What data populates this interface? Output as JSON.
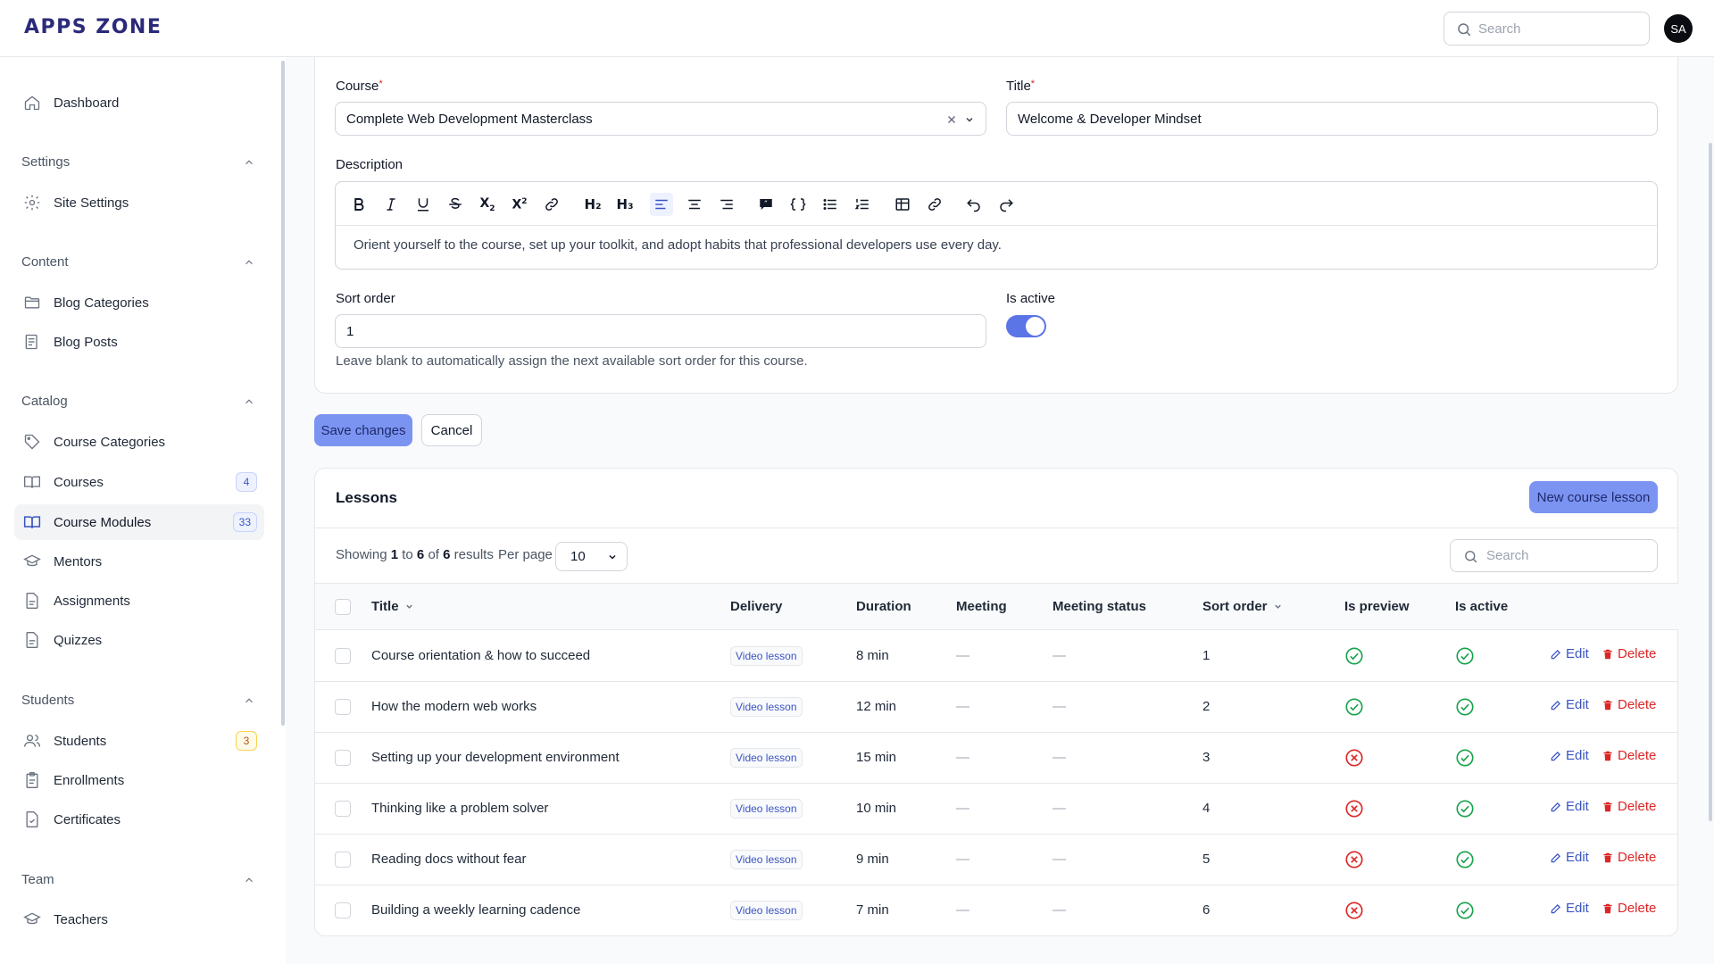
{
  "app": {
    "logo": "APPS ZONE",
    "search_placeholder": "Search",
    "avatar_initials": "SA"
  },
  "sidebar": {
    "dashboard": "Dashboard",
    "groups": {
      "settings": "Settings",
      "content": "Content",
      "catalog": "Catalog",
      "students": "Students",
      "team": "Team"
    },
    "items": {
      "site_settings": "Site Settings",
      "blog_categories": "Blog Categories",
      "blog_posts": "Blog Posts",
      "course_categories": "Course Categories",
      "courses": "Courses",
      "courses_count": "4",
      "course_modules": "Course Modules",
      "course_modules_count": "33",
      "mentors": "Mentors",
      "assignments": "Assignments",
      "quizzes": "Quizzes",
      "students": "Students",
      "students_count": "3",
      "enrollments": "Enrollments",
      "certificates": "Certificates",
      "teachers": "Teachers"
    }
  },
  "form": {
    "course_label": "Course",
    "course_value": "Complete Web Development Masterclass",
    "title_label": "Title",
    "title_value": "Welcome & Developer Mindset",
    "description_label": "Description",
    "description_value": "Orient yourself to the course, set up your toolkit, and adopt habits that professional developers use every day.",
    "sort_order_label": "Sort order",
    "sort_order_value": "1",
    "sort_order_help": "Leave blank to automatically assign the next available sort order for this course.",
    "is_active_label": "Is active",
    "is_active": true,
    "toolbar": {
      "h2": "H₂",
      "h3": "H₃"
    }
  },
  "actions": {
    "save": "Save changes",
    "cancel": "Cancel"
  },
  "lessons": {
    "title": "Lessons",
    "new_button": "New course lesson",
    "showing_prefix": "Showing",
    "from": "1",
    "to_word": "to",
    "to": "6",
    "of_word": "of",
    "total": "6",
    "results_word": "results",
    "per_page_label": "Per page",
    "per_page_value": "10",
    "search_placeholder": "Search",
    "columns": {
      "title": "Title",
      "delivery": "Delivery",
      "duration": "Duration",
      "meeting": "Meeting",
      "meeting_status": "Meeting status",
      "sort_order": "Sort order",
      "is_preview": "Is preview",
      "is_active": "Is active"
    },
    "edit_label": "Edit",
    "delete_label": "Delete",
    "rows": [
      {
        "title": "Course orientation & how to succeed",
        "delivery": "Video lesson",
        "duration": "8 min",
        "meeting": "—",
        "meeting_status": "—",
        "sort_order": "1",
        "is_preview": true,
        "is_active": true
      },
      {
        "title": "How the modern web works",
        "delivery": "Video lesson",
        "duration": "12 min",
        "meeting": "—",
        "meeting_status": "—",
        "sort_order": "2",
        "is_preview": true,
        "is_active": true
      },
      {
        "title": "Setting up your development environment",
        "delivery": "Video lesson",
        "duration": "15 min",
        "meeting": "—",
        "meeting_status": "—",
        "sort_order": "3",
        "is_preview": false,
        "is_active": true
      },
      {
        "title": "Thinking like a problem solver",
        "delivery": "Video lesson",
        "duration": "10 min",
        "meeting": "—",
        "meeting_status": "—",
        "sort_order": "4",
        "is_preview": false,
        "is_active": true
      },
      {
        "title": "Reading docs without fear",
        "delivery": "Video lesson",
        "duration": "9 min",
        "meeting": "—",
        "meeting_status": "—",
        "sort_order": "5",
        "is_preview": false,
        "is_active": true
      },
      {
        "title": "Building a weekly learning cadence",
        "delivery": "Video lesson",
        "duration": "7 min",
        "meeting": "—",
        "meeting_status": "—",
        "sort_order": "6",
        "is_preview": false,
        "is_active": true
      }
    ]
  },
  "colors": {
    "accent": "#7b94f2",
    "toggle_on": "#5b74e6",
    "success": "#16a34a",
    "danger": "#dc2626",
    "link": "#3b54c4"
  }
}
